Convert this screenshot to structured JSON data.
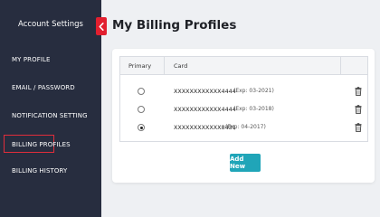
{
  "sidebar": {
    "title": "Account Settings",
    "items": [
      {
        "label": "MY PROFILE"
      },
      {
        "label": "EMAIL / PASSWORD"
      },
      {
        "label": "NOTIFICATION SETTING"
      },
      {
        "label": "BILLING PROFILES",
        "active": true
      },
      {
        "label": "BILLING HISTORY"
      }
    ]
  },
  "colors": {
    "sidebar_bg": "#272d3f",
    "active_outline": "#e02d3b",
    "collapse_tab": "#e21f2f",
    "add_button": "#20a5b8"
  },
  "icons": {
    "collapse": "chevron-left-icon",
    "delete": "trash-icon"
  },
  "page": {
    "title": "My Billing Profiles"
  },
  "table": {
    "headers": {
      "primary": "Primary",
      "card": "Card"
    },
    "rows": [
      {
        "card": "XXXXXXXXXXXX4444",
        "exp": "(Exp: 03-2021)",
        "primary": false
      },
      {
        "card": "XXXXXXXXXXXX4444",
        "exp": "(Exp: 03-2018)",
        "primary": false
      },
      {
        "card": "XXXXXXXXXXXX8431",
        "exp": "(Exp: 04-2017)",
        "primary": true
      }
    ]
  },
  "actions": {
    "add_new": "Add New"
  }
}
